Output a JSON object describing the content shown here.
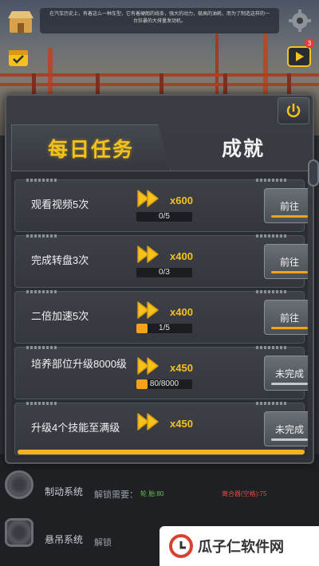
{
  "header": {
    "banner_text": "在汽车历史上，有着这么一种车型，它有着硬朗的线条，强大的动力，极高的油耗，而为了制造这样的一台狂暴的大排量发动机。",
    "video_badge_count": "3"
  },
  "icons": {
    "store": "store-icon",
    "checkin": "checkin-icon",
    "settings": "gear-icon",
    "video": "video-icon",
    "power": "power-icon",
    "reward": "fast-forward-icon"
  },
  "tabs": {
    "daily": "每日任务",
    "achievements": "成就"
  },
  "tasks": [
    {
      "title": "观看视频5次",
      "reward": "x600",
      "progress_text": "0/5",
      "progress": 0.0,
      "button": "前往"
    },
    {
      "title": "完成转盘3次",
      "reward": "x400",
      "progress_text": "0/3",
      "progress": 0.0,
      "button": "前往"
    },
    {
      "title": "二倍加速5次",
      "reward": "x400",
      "progress_text": "1/5",
      "progress": 0.2,
      "button": "前往"
    },
    {
      "title": "培养部位升级8000级",
      "reward": "x450",
      "progress_text": "80/8000",
      "progress": 0.01,
      "button": "未完成"
    },
    {
      "title": "升级4个技能至满级",
      "reward": "x450",
      "progress_text": "",
      "progress": 0.0,
      "button": "未完成"
    }
  ],
  "background_list": [
    {
      "name": "制动系统",
      "unlock_label": "解锁需要：",
      "req": "轮 胎:80",
      "red": "离合器(空格):75"
    },
    {
      "name": "悬吊系统",
      "unlock_label": "解锁",
      "req": "",
      "red": ""
    }
  ],
  "watermark": "瓜子仁软件网",
  "colors": {
    "accent": "#f5c21b",
    "progress": "#f5a21b",
    "panel": "#34373d"
  }
}
